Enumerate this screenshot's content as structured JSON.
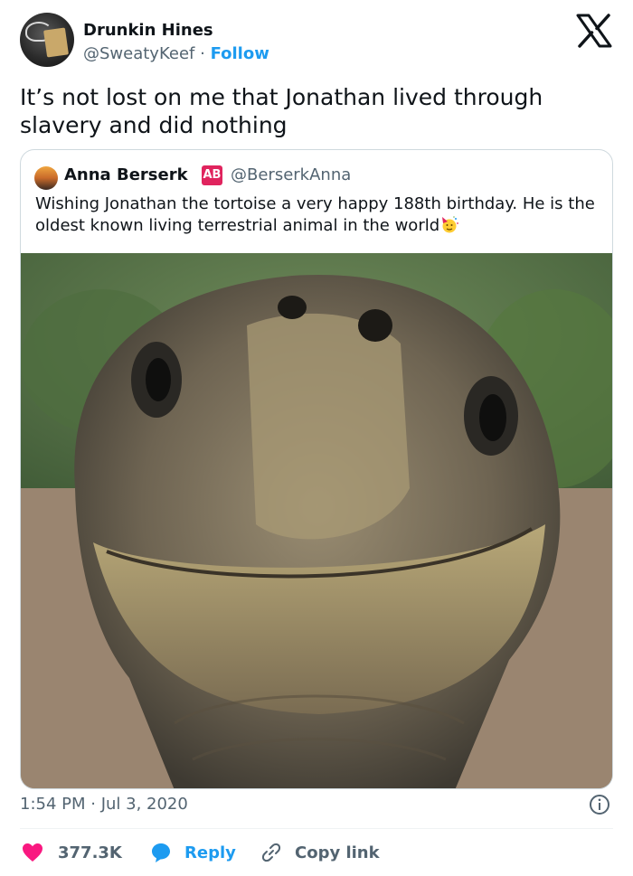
{
  "tweet": {
    "author": {
      "display_name": "Drunkin Hines",
      "handle": "@SweatyKeef",
      "separator": "·",
      "follow_label": "Follow"
    },
    "text": "It’s not lost on me that Jonathan lived through slavery and did nothing",
    "quoted": {
      "display_name": "Anna Berserk",
      "badge": "AB",
      "handle": "@BerserkAnna",
      "text": "Wishing Jonathan the tortoise a very happy 188th birthday. He is the oldest known living terrestrial animal in the world",
      "emoji": "party-face-icon"
    },
    "timestamp": "1:54 PM · Jul 3, 2020",
    "actions": {
      "like_count": "377.3K",
      "reply_label": "Reply",
      "copy_label": "Copy link"
    }
  },
  "colors": {
    "accent": "#1d9bf0",
    "like": "#f91880",
    "secondary_text": "#536471",
    "badge": "#e0245e"
  }
}
